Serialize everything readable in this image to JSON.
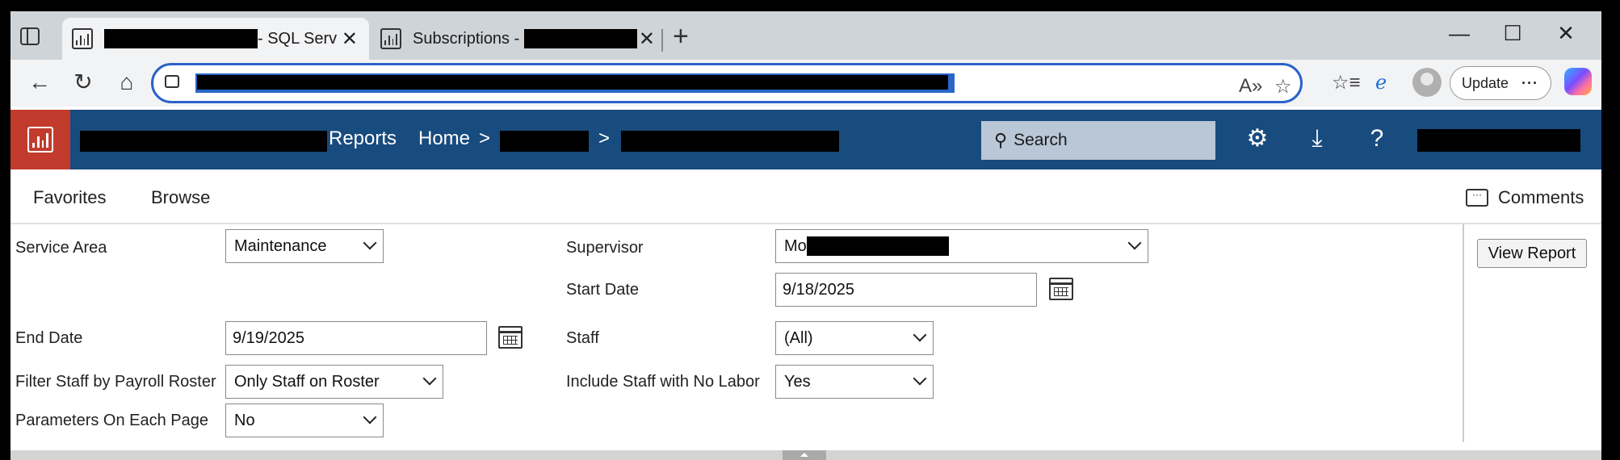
{
  "browser": {
    "tabs": [
      {
        "title": "- SQL Serv"
      },
      {
        "title": "Subscriptions -"
      }
    ],
    "update_label": "Update",
    "update_more": "···"
  },
  "header": {
    "reports_label": "Reports",
    "breadcrumb_home": "Home",
    "breadcrumb_separator": ">",
    "search_label": "Search",
    "colors": {
      "bar": "#184b7e",
      "logo": "#c23b2d"
    }
  },
  "menu": {
    "favorites": "Favorites",
    "browse": "Browse",
    "comments": "Comments"
  },
  "params": {
    "service_area": {
      "label": "Service Area",
      "value": "Maintenance"
    },
    "supervisor": {
      "label": "Supervisor",
      "value": "Mo"
    },
    "start_date": {
      "label": "Start Date",
      "value": "9/18/2025"
    },
    "end_date": {
      "label": "End Date",
      "value": "9/19/2025"
    },
    "staff": {
      "label": "Staff",
      "value": "(All)"
    },
    "filter_roster": {
      "label": "Filter Staff by Payroll Roster",
      "value": "Only Staff on Roster"
    },
    "include_no_labor": {
      "label": "Include Staff with No Labor",
      "value": "Yes"
    },
    "params_each_page": {
      "label": "Parameters On Each Page",
      "value": "No"
    },
    "view_report": "View Report"
  }
}
